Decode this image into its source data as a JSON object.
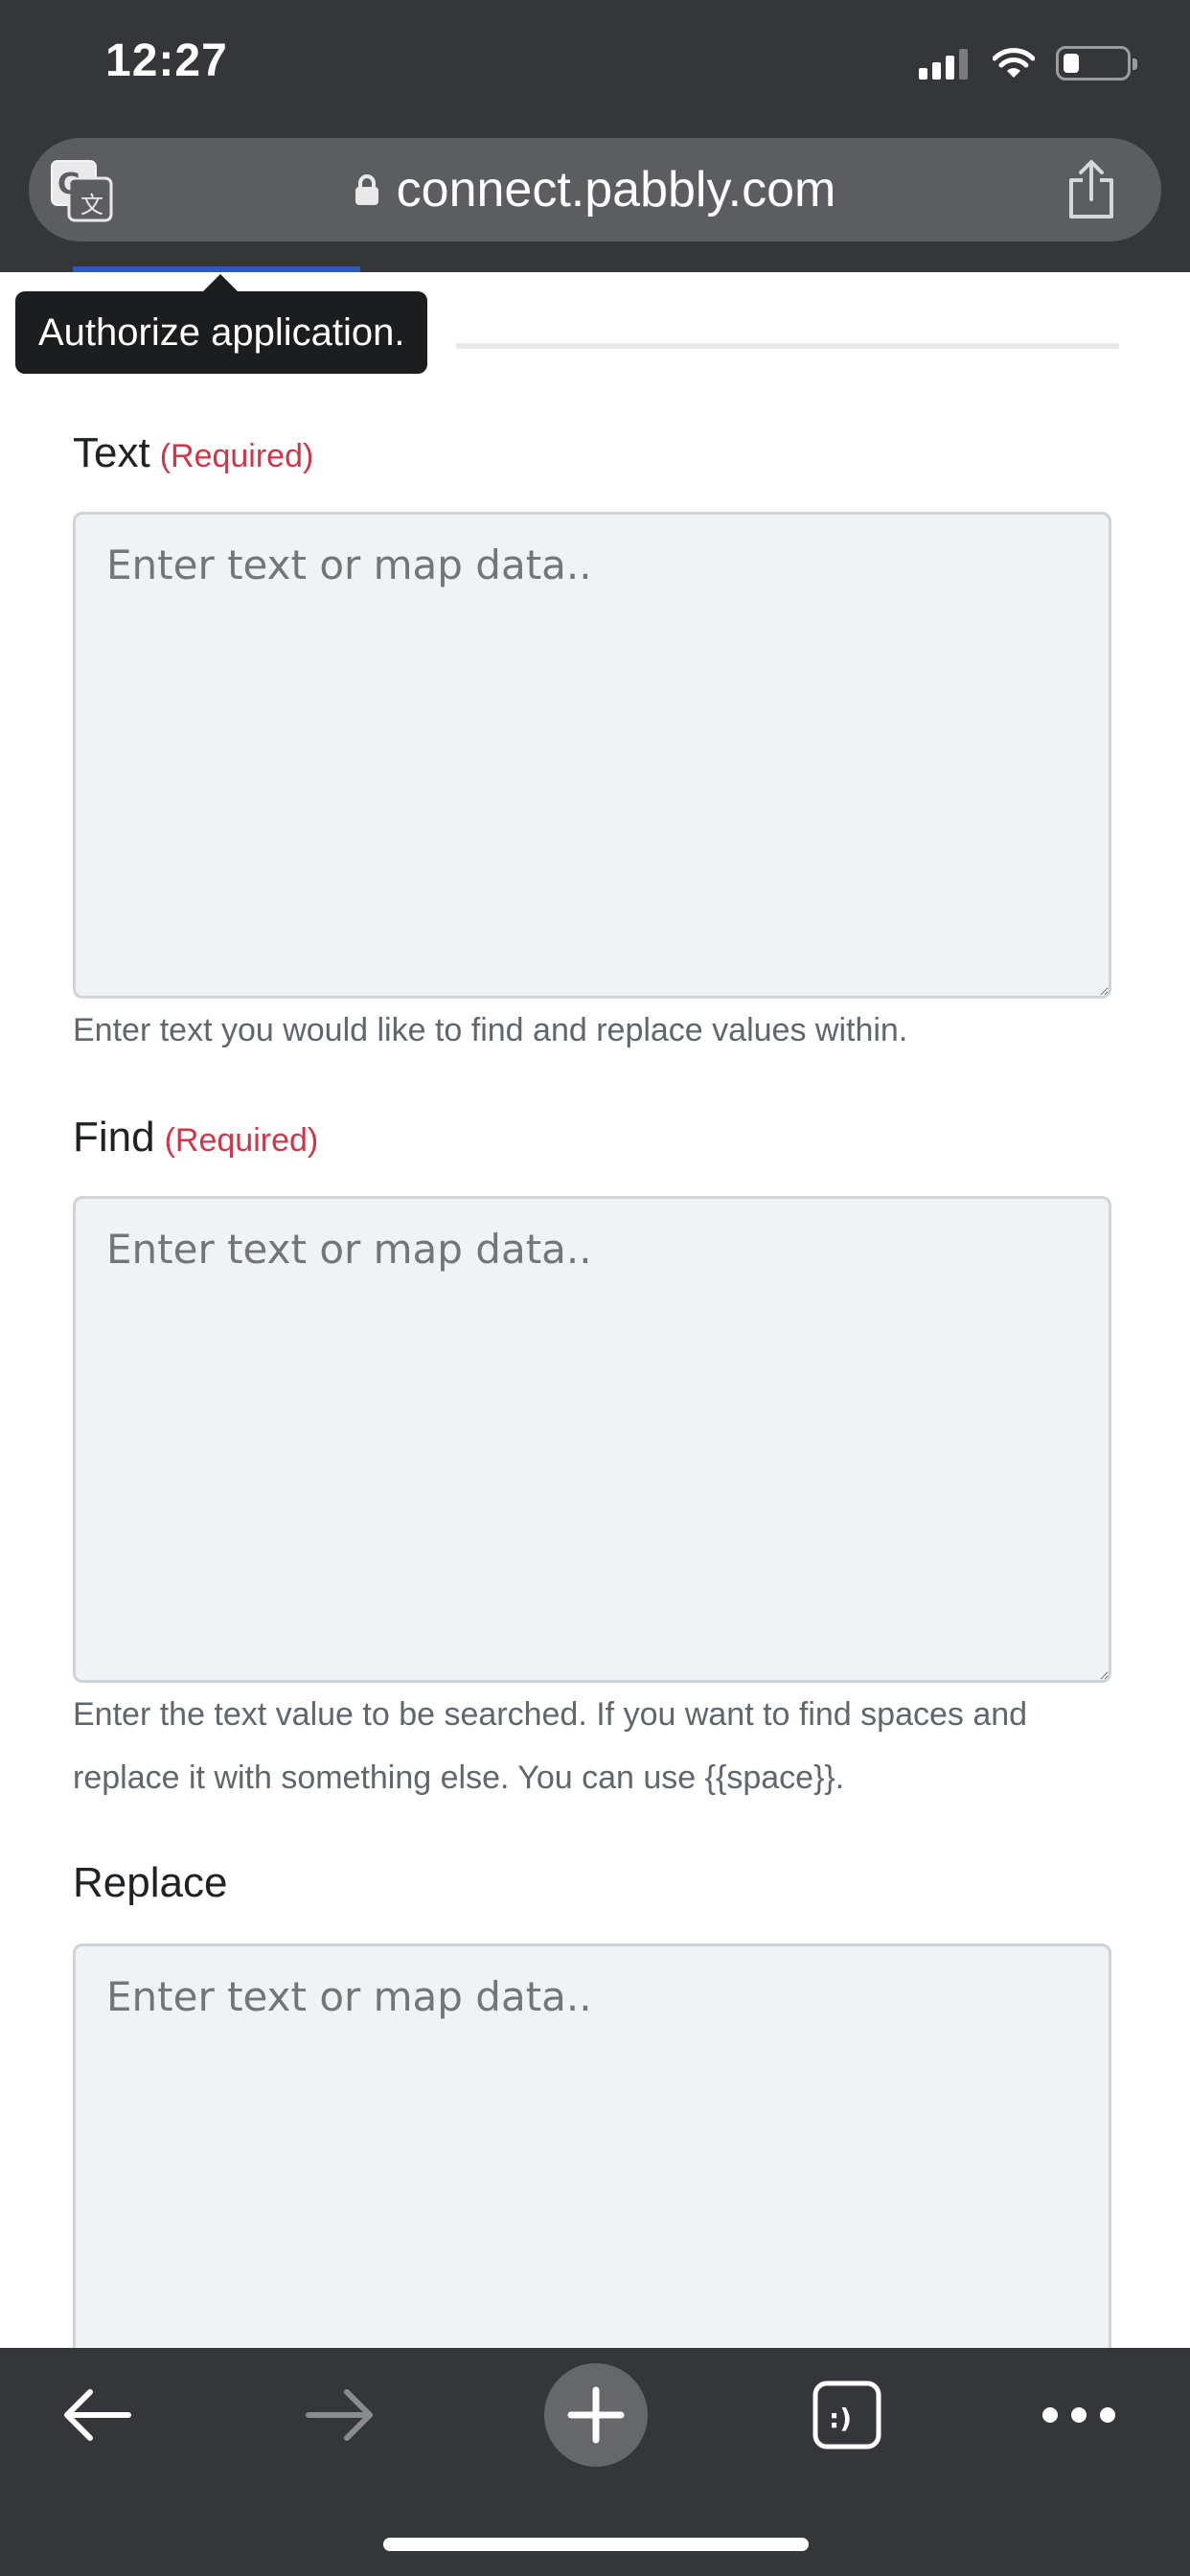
{
  "status_bar": {
    "time": "12:27"
  },
  "browser": {
    "url": "connect.pabbly.com"
  },
  "tooltip": {
    "text": "Authorize application."
  },
  "form": {
    "fields": [
      {
        "label": "Text",
        "required": "(Required)",
        "placeholder": "Enter text or map data..",
        "value": "",
        "help": "Enter text you would like to find and replace values within."
      },
      {
        "label": "Find",
        "required": "(Required)",
        "placeholder": "Enter text or map data..",
        "value": "",
        "help": "Enter the text value to be searched. If you want to find spaces and replace it with something else. You can use {{space}}."
      },
      {
        "label": "Replace",
        "placeholder": "Enter text or map data..",
        "value": ""
      }
    ]
  },
  "colors": {
    "chrome_bg": "#353639",
    "url_pill": "#5b5d61",
    "required_red": "#d0354a",
    "field_bg": "#f0f3f6"
  },
  "icons": {
    "translate": "translate-icon",
    "lock": "lock-icon",
    "share": "share-icon",
    "back": "arrow-left-icon",
    "forward": "arrow-right-icon",
    "new_tab": "plus-icon",
    "tabs": "tabs-icon",
    "more": "more-icon"
  }
}
